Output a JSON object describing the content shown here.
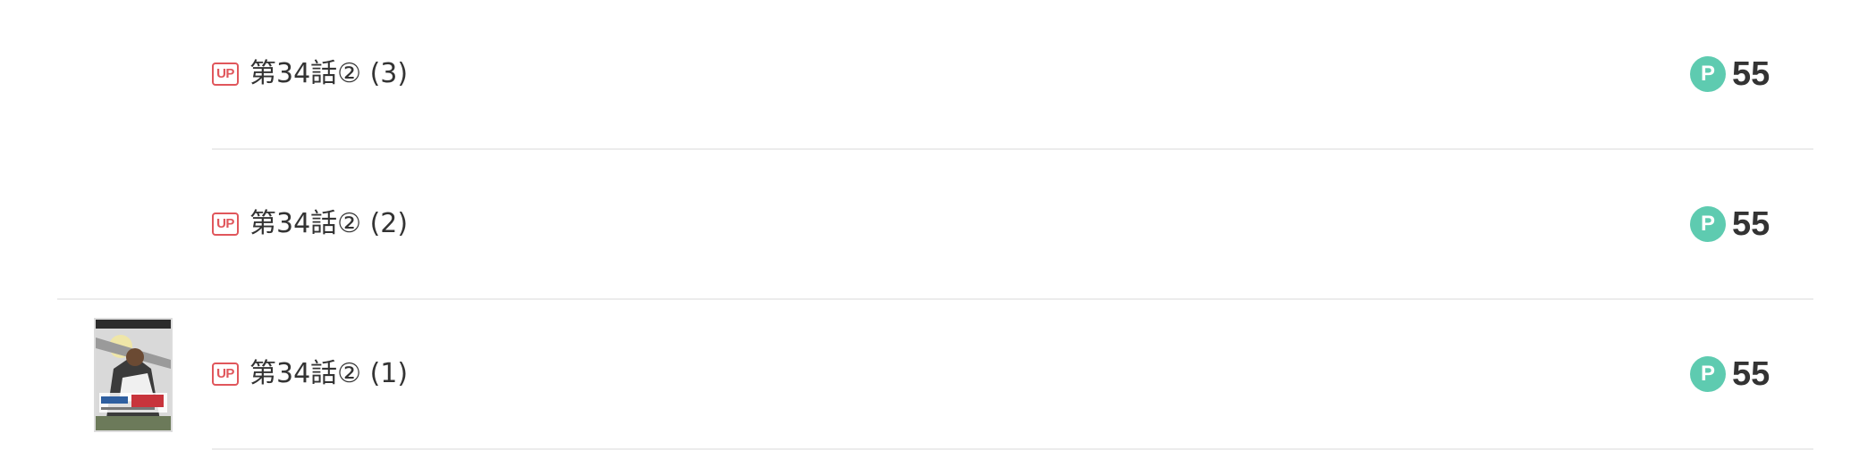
{
  "episodes": [
    {
      "badge": "UP",
      "title": "第34話② (3)",
      "point_icon": "P",
      "price": "55",
      "has_thumbnail": false
    },
    {
      "badge": "UP",
      "title": "第34話② (2)",
      "point_icon": "P",
      "price": "55",
      "has_thumbnail": false
    },
    {
      "badge": "UP",
      "title": "第34話② (1)",
      "point_icon": "P",
      "price": "55",
      "has_thumbnail": true
    }
  ],
  "colors": {
    "up_badge": "#e0565b",
    "point_icon_bg": "#5ecbb0",
    "divider": "#ececec",
    "text": "#333333"
  }
}
